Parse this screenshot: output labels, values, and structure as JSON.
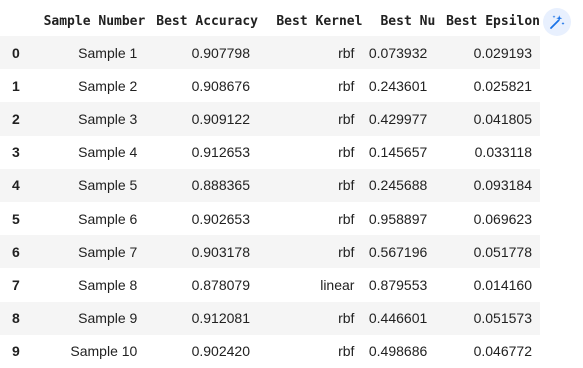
{
  "table": {
    "columns": [
      "",
      "Sample Number",
      "Best Accuracy",
      "Best Kernel",
      "Best Nu",
      "Best Epsilon"
    ],
    "rows": [
      {
        "index": "0",
        "sample": "Sample 1",
        "accuracy": "0.907798",
        "kernel": "rbf",
        "nu": "0.073932",
        "epsilon": "0.029193"
      },
      {
        "index": "1",
        "sample": "Sample 2",
        "accuracy": "0.908676",
        "kernel": "rbf",
        "nu": "0.243601",
        "epsilon": "0.025821"
      },
      {
        "index": "2",
        "sample": "Sample 3",
        "accuracy": "0.909122",
        "kernel": "rbf",
        "nu": "0.429977",
        "epsilon": "0.041805"
      },
      {
        "index": "3",
        "sample": "Sample 4",
        "accuracy": "0.912653",
        "kernel": "rbf",
        "nu": "0.145657",
        "epsilon": "0.033118"
      },
      {
        "index": "4",
        "sample": "Sample 5",
        "accuracy": "0.888365",
        "kernel": "rbf",
        "nu": "0.245688",
        "epsilon": "0.093184"
      },
      {
        "index": "5",
        "sample": "Sample 6",
        "accuracy": "0.902653",
        "kernel": "rbf",
        "nu": "0.958897",
        "epsilon": "0.069623"
      },
      {
        "index": "6",
        "sample": "Sample 7",
        "accuracy": "0.903178",
        "kernel": "rbf",
        "nu": "0.567196",
        "epsilon": "0.051778"
      },
      {
        "index": "7",
        "sample": "Sample 8",
        "accuracy": "0.878079",
        "kernel": "linear",
        "nu": "0.879553",
        "epsilon": "0.014160"
      },
      {
        "index": "8",
        "sample": "Sample 9",
        "accuracy": "0.912081",
        "kernel": "rbf",
        "nu": "0.446601",
        "epsilon": "0.051573"
      },
      {
        "index": "9",
        "sample": "Sample 10",
        "accuracy": "0.902420",
        "kernel": "rbf",
        "nu": "0.498686",
        "epsilon": "0.046772"
      }
    ]
  },
  "actions": {
    "magic_icon": "magic-wand-sparkle-icon",
    "accent_color": "#1a73e8",
    "button_bg": "#e8f0fe"
  }
}
